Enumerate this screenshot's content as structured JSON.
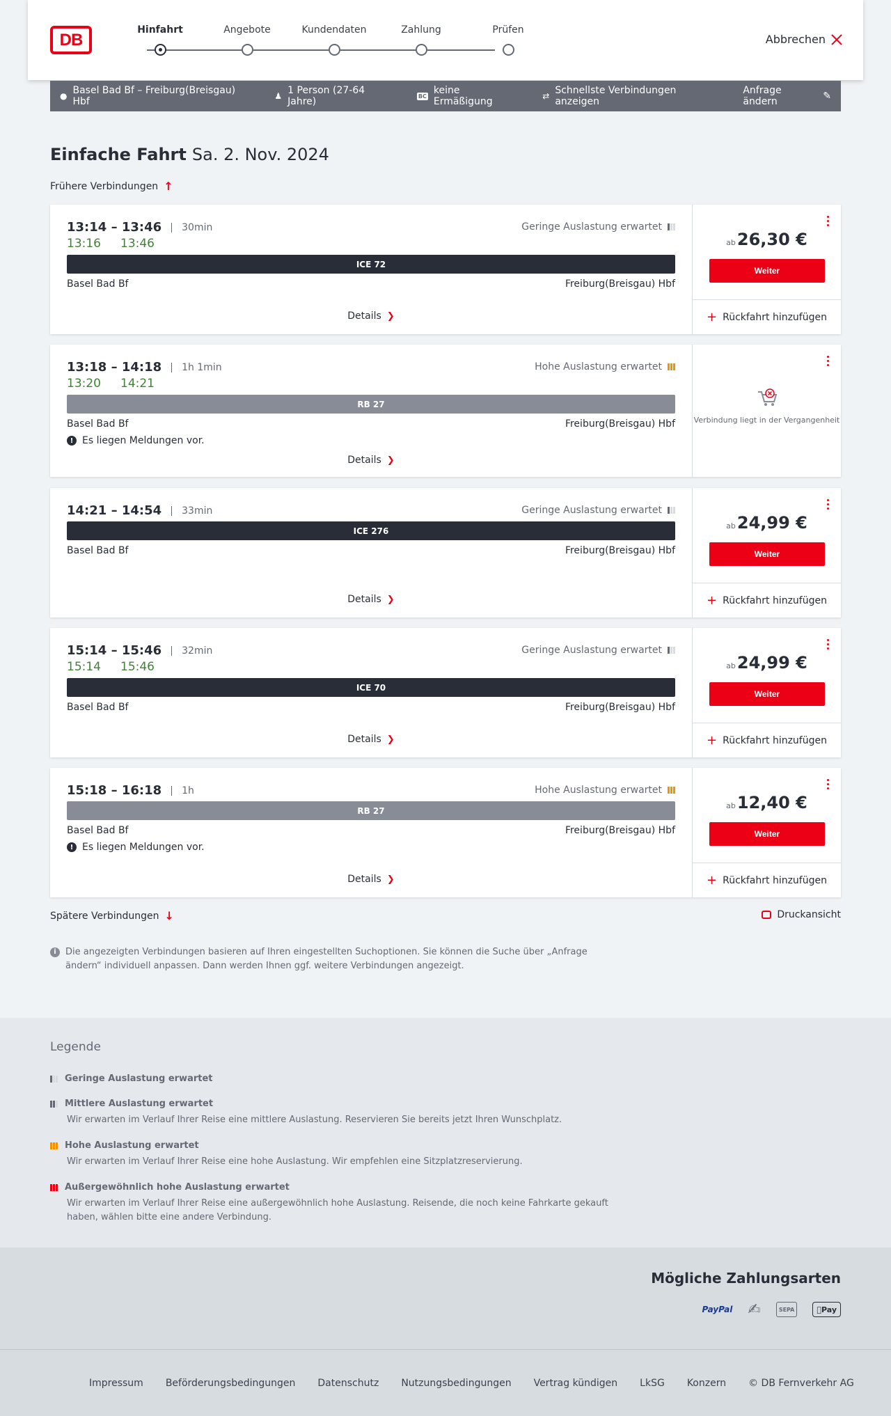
{
  "header": {
    "steps": [
      "Hinfahrt",
      "Angebote",
      "Kundendaten",
      "Zahlung",
      "Prüfen"
    ],
    "active_step": 0,
    "logo": "DB",
    "cancel_label": "Abbrechen"
  },
  "query": {
    "route": "Basel Bad Bf – Freiburg(Breisgau) Hbf",
    "persons": "1 Person (27-64 Jahre)",
    "discount_badge": "BC",
    "discount": "keine Ermäßigung",
    "fastest": "Schnellste Verbindungen anzeigen",
    "change": "Anfrage ändern"
  },
  "title": {
    "trip": "Einfache Fahrt",
    "date": "Sa. 2. Nov. 2024"
  },
  "earlier": "Frühere Verbindungen",
  "later": "Spätere Verbindungen",
  "print": "Druckansicht",
  "labels": {
    "details": "Details",
    "weiter": "Weiter",
    "ruck": "Rückfahrt hinzufügen",
    "ab": "ab",
    "message": "Es liegen Meldungen vor.",
    "past": "Verbindung liegt in der Vergangenheit",
    "from": "Basel Bad Bf",
    "to": "Freiburg(Breisgau) Hbf"
  },
  "connections": [
    {
      "time": "13:14 – 13:46",
      "duration": "30min",
      "rt_dep": "13:16",
      "rt_arr": "13:46",
      "load": "Geringe Auslastung erwartet",
      "train": "ICE 72",
      "price": "26,30 €"
    },
    {
      "time": "13:18 – 14:18",
      "duration": "1h 1min",
      "rt_dep": "13:20",
      "rt_arr": "14:21",
      "load": "Hohe Auslastung erwartet",
      "train": "RB 27",
      "price": ""
    },
    {
      "time": "14:21 – 14:54",
      "duration": "33min",
      "rt_dep": "",
      "rt_arr": "",
      "load": "Geringe Auslastung erwartet",
      "train": "ICE 276",
      "price": "24,99 €"
    },
    {
      "time": "15:14 – 15:46",
      "duration": "32min",
      "rt_dep": "15:14",
      "rt_arr": "15:46",
      "load": "Geringe Auslastung erwartet",
      "train": "ICE 70",
      "price": "24,99 €"
    },
    {
      "time": "15:18 – 16:18",
      "duration": "1h",
      "rt_dep": "",
      "rt_arr": "",
      "load": "Hohe Auslastung erwartet",
      "train": "RB 27",
      "price": "12,40 €"
    }
  ],
  "info": "Die angezeigten Verbindungen basieren auf Ihren eingestellten Suchoptionen. Sie können die Suche über „Anfrage ändern“ individuell anpassen. Dann werden Ihnen ggf. weitere Verbindungen angezeigt.",
  "legend": {
    "title": "Legende",
    "items": [
      {
        "title": "Geringe Auslastung erwartet",
        "desc": ""
      },
      {
        "title": "Mittlere Auslastung erwartet",
        "desc": "Wir erwarten im Verlauf Ihrer Reise eine mittlere Auslastung. Reservieren Sie bereits jetzt Ihren Wunschplatz."
      },
      {
        "title": "Hohe Auslastung erwartet",
        "desc": "Wir erwarten im Verlauf Ihrer Reise eine hohe Auslastung. Wir empfehlen eine Sitzplatzreservierung."
      },
      {
        "title": "Außergewöhnlich hohe Auslastung erwartet",
        "desc": "Wir erwarten im Verlauf Ihrer Reise eine außergewöhnlich hohe Auslastung. Reisende, die noch keine Fahrkarte gekauft haben, wählen bitte eine andere Verbindung."
      }
    ]
  },
  "payments": {
    "title": "Mögliche Zahlungsarten",
    "methods": [
      "PayPal",
      "SEPA",
      "Pay"
    ]
  },
  "footer": [
    "Impressum",
    "Beförderungsbedingungen",
    "Datenschutz",
    "Nutzungsbedingungen",
    "Vertrag kündigen",
    "LkSG",
    "Konzern",
    "© DB Fernverkehr AG"
  ],
  "colors": {
    "accent": "#ec0016",
    "realtime": "#408335",
    "ice_bar": "#282d37",
    "regio_bar": "#878c96",
    "high_load": "#f39200"
  }
}
